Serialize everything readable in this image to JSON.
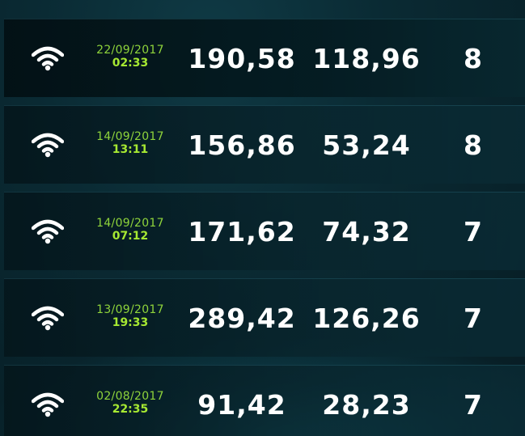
{
  "results": [
    {
      "date": "22/09/2017",
      "time": "02:33",
      "download": "190,58",
      "upload": "118,96",
      "count": "8"
    },
    {
      "date": "14/09/2017",
      "time": "13:11",
      "download": "156,86",
      "upload": "53,24",
      "count": "8"
    },
    {
      "date": "14/09/2017",
      "time": "07:12",
      "download": "171,62",
      "upload": "74,32",
      "count": "7"
    },
    {
      "date": "13/09/2017",
      "time": "19:33",
      "download": "289,42",
      "upload": "126,26",
      "count": "7"
    },
    {
      "date": "02/08/2017",
      "time": "22:35",
      "download": "91,42",
      "upload": "28,23",
      "count": "7"
    }
  ],
  "colors": {
    "date": "#8fd43b",
    "time": "#a6e832",
    "value": "#ffffff",
    "background": "#0a2a33"
  },
  "icons": {
    "connection": "wifi-icon"
  }
}
